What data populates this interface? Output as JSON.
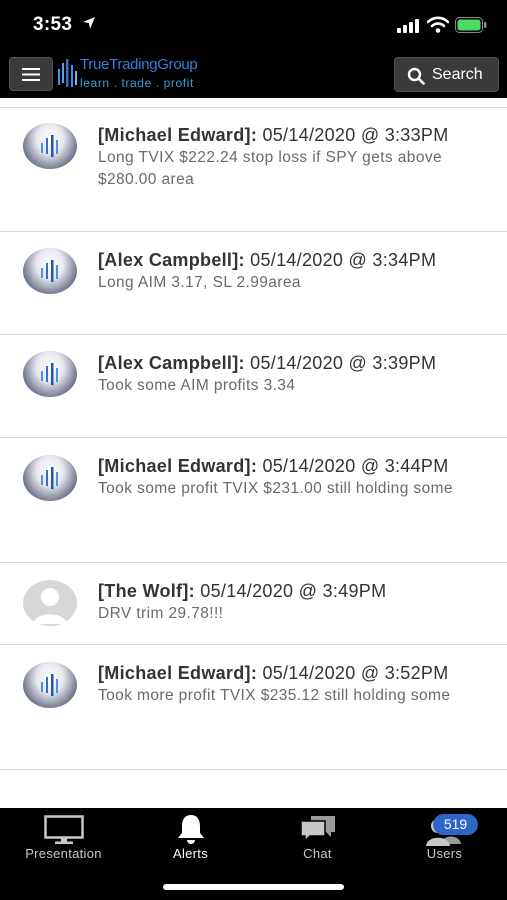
{
  "status_bar": {
    "time": "3:53"
  },
  "header": {
    "logo_title": "TrueTradingGroup",
    "logo_tagline": "learn . trade . profit",
    "search_label": "Search"
  },
  "alerts": [
    {
      "author": "[Michael Edward]:",
      "timestamp": "05/14/2020 @ 3:33PM",
      "message": "Long TVIX $222.24 stop loss if SPY gets above $280.00 area",
      "avatar": "logo"
    },
    {
      "author": "[Alex Campbell]:",
      "timestamp": "05/14/2020 @ 3:34PM",
      "message": "Long AIM 3.17, SL 2.99area",
      "avatar": "logo"
    },
    {
      "author": "[Alex Campbell]:",
      "timestamp": "05/14/2020 @ 3:39PM",
      "message": "Took some AIM profits 3.34",
      "avatar": "logo"
    },
    {
      "author": "[Michael Edward]:",
      "timestamp": "05/14/2020 @ 3:44PM",
      "message": "Took some profit TVIX $231.00 still holding some",
      "avatar": "logo"
    },
    {
      "author": "[The Wolf]:",
      "timestamp": "05/14/2020 @ 3:49PM",
      "message": "DRV trim 29.78!!!",
      "avatar": "default"
    },
    {
      "author": "[Michael Edward]:",
      "timestamp": "05/14/2020 @ 3:52PM",
      "message": "Took more profit TVIX $235.12 still holding some",
      "avatar": "logo"
    }
  ],
  "tabs": [
    {
      "label": "Presentation",
      "icon": "monitor-icon",
      "active": false
    },
    {
      "label": "Alerts",
      "icon": "bell-icon",
      "active": true
    },
    {
      "label": "Chat",
      "icon": "chat-bubbles-icon",
      "active": false
    },
    {
      "label": "Users",
      "icon": "users-icon",
      "active": false,
      "badge": "519"
    }
  ],
  "colors": {
    "bar_background": "#000000",
    "brand_blue": "#3b7bd6",
    "badge_blue": "#2e66c8",
    "message_gray": "#6a6a6a"
  }
}
